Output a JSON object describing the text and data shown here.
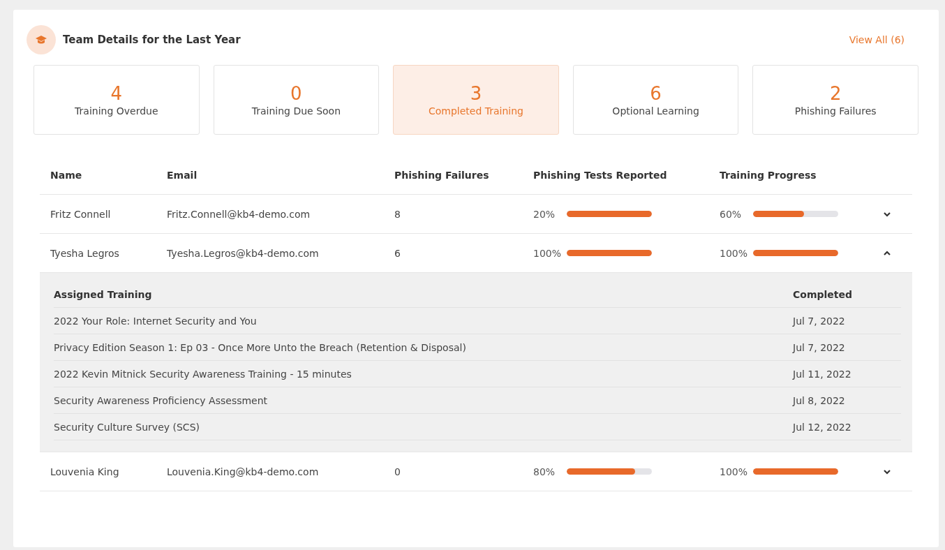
{
  "header": {
    "title": "Team Details for the Last Year",
    "link": "View All (6)"
  },
  "stats": [
    {
      "value": "4",
      "label": "Training Overdue",
      "selected": false
    },
    {
      "value": "0",
      "label": "Training Due Soon",
      "selected": false
    },
    {
      "value": "3",
      "label": "Completed Training",
      "selected": true
    },
    {
      "value": "6",
      "label": "Optional Learning",
      "selected": false
    },
    {
      "value": "2",
      "label": "Phishing Failures",
      "selected": false
    }
  ],
  "table": {
    "columns": [
      "Name",
      "Email",
      "Phishing Failures",
      "Phishing Tests Reported",
      "Training Progress"
    ],
    "rows": [
      {
        "name": "Fritz Connell",
        "email": "Fritz.Connell@kb4-demo.com",
        "failures": "8",
        "reported": {
          "reading": "20%",
          "level": 1
        },
        "progress": {
          "reading": "60%",
          "level": 0.6
        },
        "expanded": false
      },
      {
        "name": "Tyesha Legros",
        "email": "Tyesha.Legros@kb4-demo.com",
        "failures": "6",
        "reported": {
          "reading": "100%",
          "level": 1
        },
        "progress": {
          "reading": "100%",
          "level": 1
        },
        "expanded": true,
        "details": {
          "columns": [
            "Assigned Training",
            "Completed"
          ],
          "rows": [
            [
              "2022 Your Role: Internet Security and You",
              "Jul 7, 2022"
            ],
            [
              "Privacy Edition Season 1: Ep 03 - Once More Unto the Breach (Retention & Disposal)",
              "Jul 7, 2022"
            ],
            [
              "2022 Kevin Mitnick Security Awareness Training - 15 minutes",
              "Jul 11, 2022"
            ],
            [
              "Security Awareness Proficiency Assessment",
              "Jul 8, 2022"
            ],
            [
              "Security Culture Survey (SCS)",
              "Jul 12, 2022"
            ]
          ]
        }
      },
      {
        "name": "Louvenia King",
        "email": "Louvenia.King@kb4-demo.com",
        "failures": "0",
        "reported": {
          "reading": "80%",
          "level": 0.8
        },
        "progress": {
          "reading": "100%",
          "level": 1
        },
        "expanded": false
      }
    ]
  }
}
